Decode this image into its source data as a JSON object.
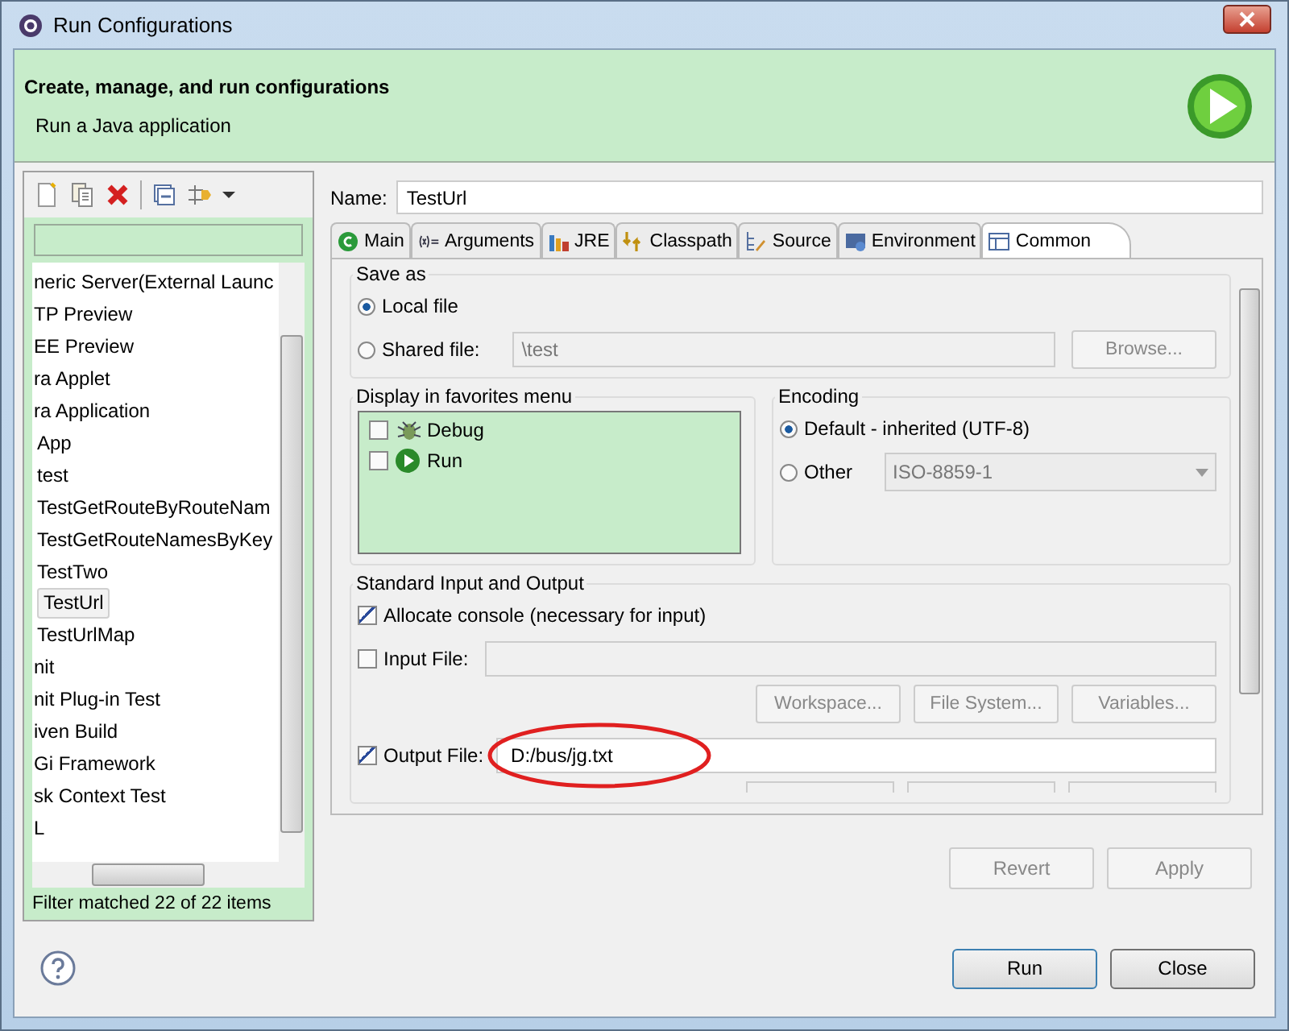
{
  "window": {
    "title": "Run Configurations"
  },
  "header": {
    "title": "Create, manage, and run configurations",
    "subtitle": "Run a Java application"
  },
  "sidebar": {
    "items": [
      {
        "label": "neric Server(External Launc",
        "selected": false
      },
      {
        "label": "TP Preview",
        "selected": false
      },
      {
        "label": "EE Preview",
        "selected": false
      },
      {
        "label": "ra Applet",
        "selected": false
      },
      {
        "label": "ra Application",
        "selected": false,
        "children": [
          {
            "label": "App",
            "selected": false
          },
          {
            "label": "test",
            "selected": false
          },
          {
            "label": "TestGetRouteByRouteNam",
            "selected": false
          },
          {
            "label": "TestGetRouteNamesByKey",
            "selected": false
          },
          {
            "label": "TestTwo",
            "selected": false
          },
          {
            "label": "TestUrl",
            "selected": true
          },
          {
            "label": "TestUrlMap",
            "selected": false
          }
        ]
      },
      {
        "label": "nit",
        "selected": false
      },
      {
        "label": "nit Plug-in Test",
        "selected": false
      },
      {
        "label": "iven Build",
        "selected": false
      },
      {
        "label": "Gi Framework",
        "selected": false
      },
      {
        "label": "sk Context Test",
        "selected": false
      },
      {
        "label": "L",
        "selected": false
      }
    ],
    "status": "Filter matched 22 of 22 items"
  },
  "name": {
    "label": "Name:",
    "value": "TestUrl"
  },
  "tabs": [
    {
      "label": "Main",
      "selected": false
    },
    {
      "label": "Arguments",
      "selected": false
    },
    {
      "label": "JRE",
      "selected": false
    },
    {
      "label": "Classpath",
      "selected": false
    },
    {
      "label": "Source",
      "selected": false
    },
    {
      "label": "Environment",
      "selected": false
    },
    {
      "label": "Common",
      "selected": true
    }
  ],
  "save_as": {
    "title": "Save as",
    "options": [
      {
        "label": "Local file",
        "selected": true
      },
      {
        "label": "Shared file:",
        "selected": false
      }
    ],
    "shared_path": "\\test",
    "browse": "Browse..."
  },
  "favorites": {
    "title": "Display in favorites menu",
    "items": [
      {
        "label": "Debug",
        "checked": false
      },
      {
        "label": "Run",
        "checked": false
      }
    ]
  },
  "encoding": {
    "title": "Encoding",
    "options": [
      {
        "label": "Default - inherited (UTF-8)",
        "selected": true
      },
      {
        "label": "Other",
        "selected": false
      }
    ],
    "other_value": "ISO-8859-1"
  },
  "io": {
    "title": "Standard Input and Output",
    "allocate": {
      "label": "Allocate console (necessary for input)",
      "checked": true
    },
    "input": {
      "label": "Input File:",
      "checked": false
    },
    "buttons": [
      "Workspace...",
      "File System...",
      "Variables..."
    ],
    "output": {
      "label": "Output File:",
      "checked": true,
      "value": "D:/bus/jg.txt"
    }
  },
  "actions": [
    "Revert",
    "Apply"
  ],
  "buttons": [
    "Run",
    "Close"
  ]
}
